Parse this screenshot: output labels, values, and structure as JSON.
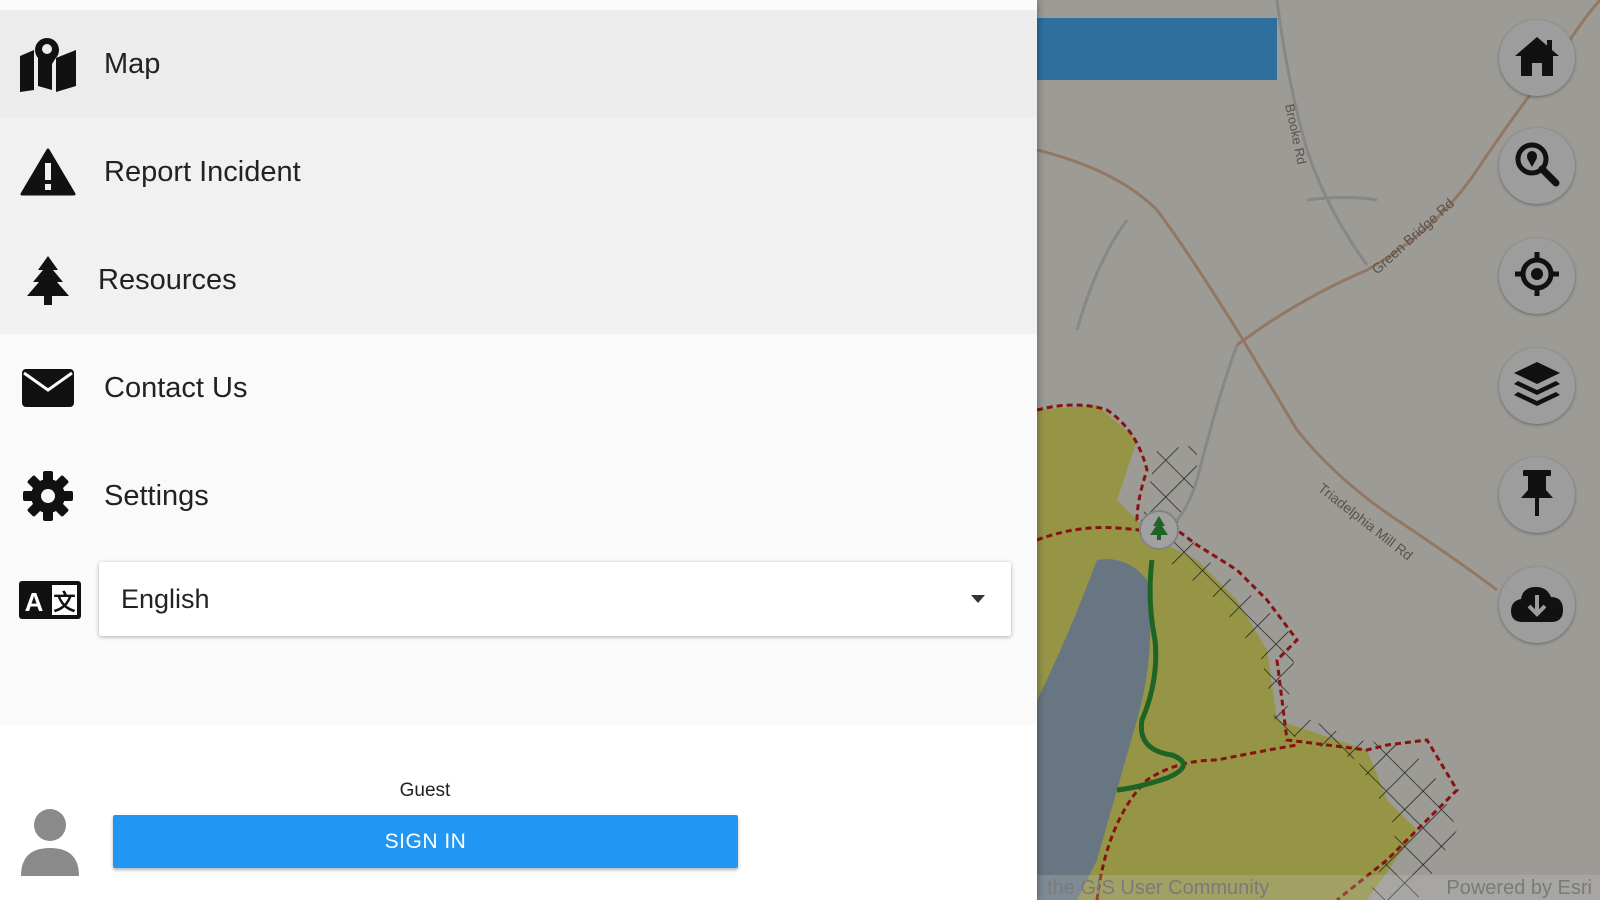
{
  "menu": {
    "items": [
      {
        "label": "Map",
        "icon": "map-icon"
      },
      {
        "label": "Report Incident",
        "icon": "warning-icon"
      },
      {
        "label": "Resources",
        "icon": "tree-icon"
      },
      {
        "label": "Contact Us",
        "icon": "envelope-icon"
      },
      {
        "label": "Settings",
        "icon": "gear-icon"
      }
    ]
  },
  "language": {
    "icon": "language-icon",
    "selected": "English"
  },
  "user": {
    "name": "Guest",
    "avatar_icon": "user-icon",
    "sign_in_label": "SIGN IN"
  },
  "map": {
    "controls": [
      "home-icon",
      "search-icon",
      "locate-icon",
      "layers-icon",
      "pin-icon",
      "cloud-download-icon"
    ],
    "road_labels": [
      "Brooke Rd",
      "Green Bridge Rd",
      "Triadelphia Mill Rd"
    ],
    "attribution_left": "the GIS User Community",
    "attribution_right": "Powered by Esri",
    "colors": {
      "base": "#f2efe6",
      "park": "#e6e46a",
      "water": "#9fb6c8",
      "boundary": "#d01c1c",
      "trail": "#2f9a3a",
      "bar": "#2f6f9e"
    }
  },
  "colors": {
    "accent": "#2196f3",
    "selected_item_bg": "#ececec"
  }
}
